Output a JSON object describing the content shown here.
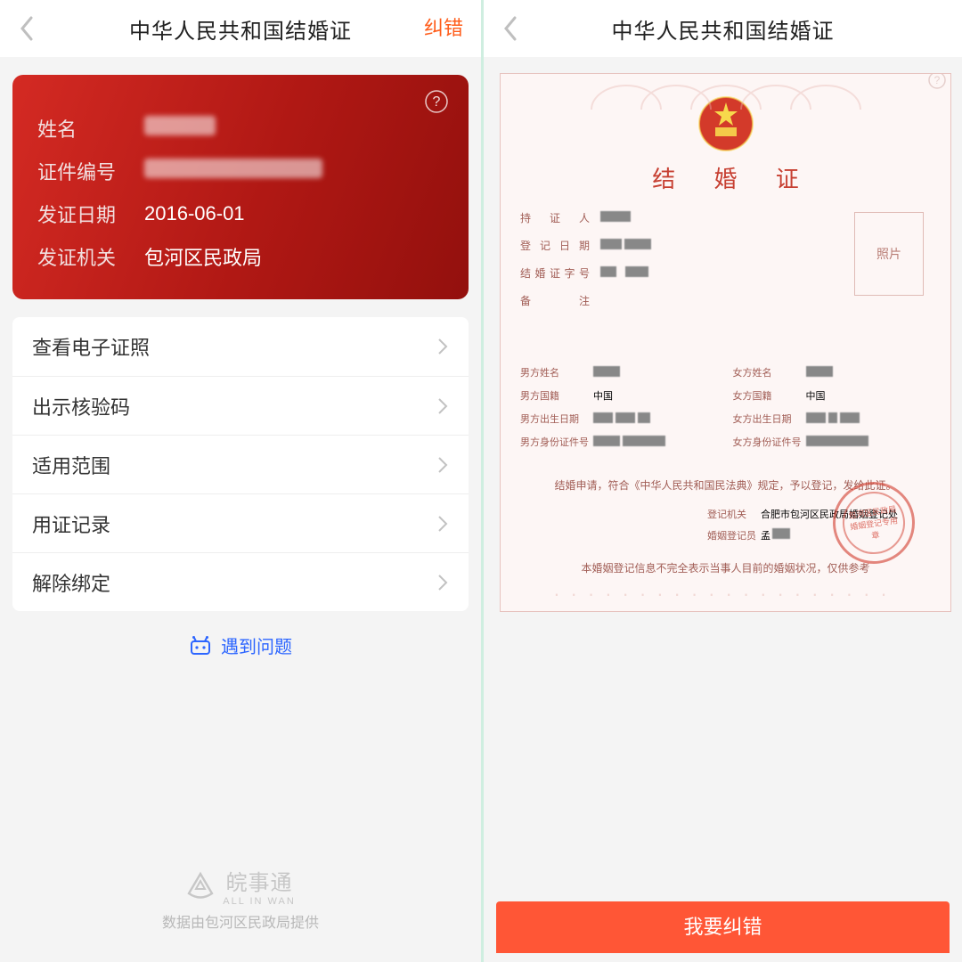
{
  "left": {
    "header": {
      "title": "中华人民共和国结婚证",
      "action": "纠错"
    },
    "card": {
      "rows": [
        {
          "label": "姓名",
          "value": ""
        },
        {
          "label": "证件编号",
          "value": ""
        },
        {
          "label": "发证日期",
          "value": "2016-06-01"
        },
        {
          "label": "发证机关",
          "value": "包河区民政局"
        }
      ]
    },
    "menu": [
      "查看电子证照",
      "出示核验码",
      "适用范围",
      "用证记录",
      "解除绑定"
    ],
    "problem": "遇到问题",
    "footer": {
      "brand_zh": "皖事通",
      "brand_en": "ALL IN WAN",
      "source": "数据由包河区民政局提供"
    }
  },
  "right": {
    "header": {
      "title": "中华人民共和国结婚证"
    },
    "certificate": {
      "title": "结 婚 证",
      "top_fields": [
        {
          "label": "持 证 人"
        },
        {
          "label": "登记日期"
        },
        {
          "label": "结婚证字号"
        },
        {
          "label": "备注"
        }
      ],
      "photo_label": "照片",
      "male": [
        {
          "label": "男方姓名",
          "value": ""
        },
        {
          "label": "男方国籍",
          "value": "中国"
        },
        {
          "label": "男方出生日期",
          "value": ""
        },
        {
          "label": "男方身份证件号",
          "value": ""
        }
      ],
      "female": [
        {
          "label": "女方姓名",
          "value": ""
        },
        {
          "label": "女方国籍",
          "value": "中国"
        },
        {
          "label": "女方出生日期",
          "value": ""
        },
        {
          "label": "女方身份证件号",
          "value": ""
        }
      ],
      "statement": "结婚申请，符合《中华人民共和国民法典》规定，予以登记，发给此证。",
      "registry_office_label": "登记机关",
      "registry_office_value": "合肥市包河区民政局婚姻登记处",
      "registrar_label": "婚姻登记员",
      "registrar_value": "孟",
      "seal_text": "包河区民政局 婚姻登记专用章",
      "disclaimer": "本婚姻登记信息不完全表示当事人目前的婚姻状况，仅供参考"
    },
    "report_button": "我要纠错"
  }
}
